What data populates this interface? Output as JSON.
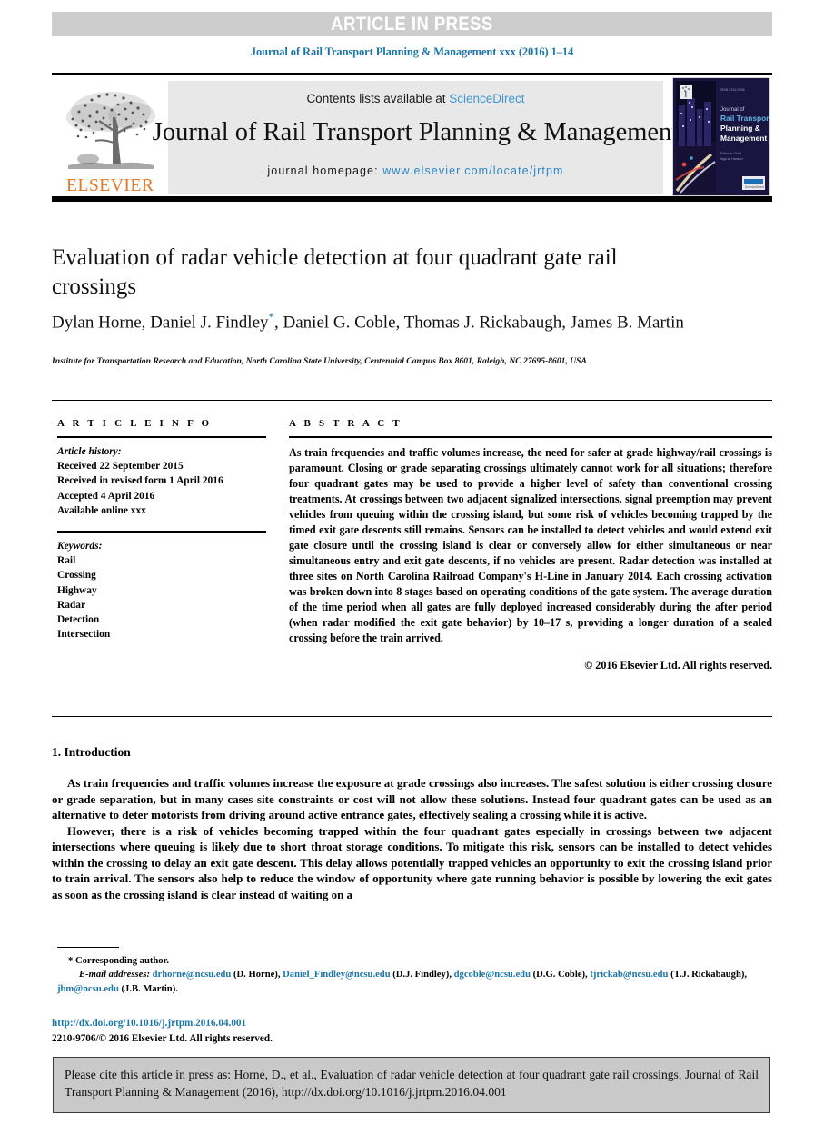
{
  "banner": {
    "label": "ARTICLE IN PRESS"
  },
  "running_head": "Journal of Rail Transport Planning & Management xxx (2016) 1–14",
  "masthead": {
    "contents_prefix": "Contents lists available at ",
    "sciencedirect": "ScienceDirect",
    "journal_title": "Journal of Rail Transport Planning & Management",
    "homepage_label": "journal homepage: ",
    "homepage_url": "www.elsevier.com/locate/jrtpm",
    "publisher_wordmark": "ELSEVIER",
    "cover_title_line1": "Journal of",
    "cover_title_line2": "Rail Transport",
    "cover_title_line3": "Planning &",
    "cover_title_line4": "Management"
  },
  "article": {
    "title": "Evaluation of radar vehicle detection at four quadrant gate rail crossings",
    "authors": "Dylan Horne, Daniel J. Findley",
    "corresponding_marker": "*",
    "authors_rest": ", Daniel G. Coble, Thomas J. Rickabaugh, James B. Martin",
    "affiliation": "Institute for Transportation Research and Education, North Carolina State University, Centennial Campus Box 8601, Raleigh, NC 27695-8601, USA"
  },
  "info": {
    "heading": "A R T I C L E   I N F O",
    "history_label": "Article history:",
    "history": [
      "Received 22 September 2015",
      "Received in revised form 1 April 2016",
      "Accepted 4 April 2016",
      "Available online xxx"
    ],
    "keywords_label": "Keywords:",
    "keywords": [
      "Rail",
      "Crossing",
      "Highway",
      "Radar",
      "Detection",
      "Intersection"
    ]
  },
  "abstract": {
    "heading": "A B S T R A C T",
    "text": "As train frequencies and traffic volumes increase, the need for safer at grade highway/rail crossings is paramount. Closing or grade separating crossings ultimately cannot work for all situations; therefore four quadrant gates may be used to provide a higher level of safety than conventional crossing treatments. At crossings between two adjacent signalized intersections, signal preemption may prevent vehicles from queuing within the crossing island, but some risk of vehicles becoming trapped by the timed exit gate descents still remains. Sensors can be installed to detect vehicles and would extend exit gate closure until the crossing island is clear or conversely allow for either simultaneous or near simultaneous entry and exit gate descents, if no vehicles are present. Radar detection was installed at three sites on North Carolina Railroad Company's H-Line in January 2014. Each crossing activation was broken down into 8 stages based on operating conditions of the gate system. The average duration of the time period when all gates are fully deployed increased considerably during the after period (when radar modified the exit gate behavior) by 10–17 s, providing a longer duration of a sealed crossing before the train arrived.",
    "copyright": "© 2016 Elsevier Ltd. All rights reserved."
  },
  "body": {
    "section_heading": "1. Introduction",
    "paragraph_1": "As train frequencies and traffic volumes increase the exposure at grade crossings also increases. The safest solution is either crossing closure or grade separation, but in many cases site constraints or cost will not allow these solutions. Instead four quadrant gates can be used as an alternative to deter motorists from driving around active entrance gates, effectively sealing a crossing while it is active.",
    "paragraph_2": "However, there is a risk of vehicles becoming trapped within the four quadrant gates especially in crossings between two adjacent intersections where queuing is likely due to short throat storage conditions. To mitigate this risk, sensors can be installed to detect vehicles within the crossing to delay an exit gate descent. This delay allows potentially trapped vehicles an opportunity to exit the crossing island prior to train arrival. The sensors also help to reduce the window of opportunity where gate running behavior is possible by lowering the exit gates as soon as the crossing island is clear instead of waiting on a"
  },
  "footnote": {
    "corresponding": "* Corresponding author.",
    "email_label": "E-mail addresses:",
    "emails": [
      {
        "address": "drhorne@ncsu.edu",
        "name": "(D. Horne)"
      },
      {
        "address": "Daniel_Findley@ncsu.edu",
        "name": "(D.J. Findley)"
      },
      {
        "address": "dgcoble@ncsu.edu",
        "name": "(D.G. Coble)"
      },
      {
        "address": "tjrickab@ncsu.edu",
        "name": "(T.J. Rickabaugh)"
      },
      {
        "address": "jbm@ncsu.edu",
        "name": "(J.B. Martin)"
      }
    ],
    "doi_url": "http://dx.doi.org/10.1016/j.jrtpm.2016.04.001",
    "issn_line": "2210-9706/© 2016 Elsevier Ltd. All rights reserved."
  },
  "cite_box": {
    "text": "Please cite this article in press as: Horne, D., et al., Evaluation of radar vehicle detection at four quadrant gate rail crossings, Journal of Rail Transport Planning & Management (2016), http://dx.doi.org/10.1016/j.jrtpm.2016.04.001"
  },
  "colors": {
    "banner_bg": "#cdcdcd",
    "link_blue": "#1b76a8",
    "sciencedirect_blue": "#3f97d3",
    "elsevier_orange": "#e87722",
    "masthead_bg": "#e8e8e8",
    "cite_bg": "#c9c9c9"
  }
}
